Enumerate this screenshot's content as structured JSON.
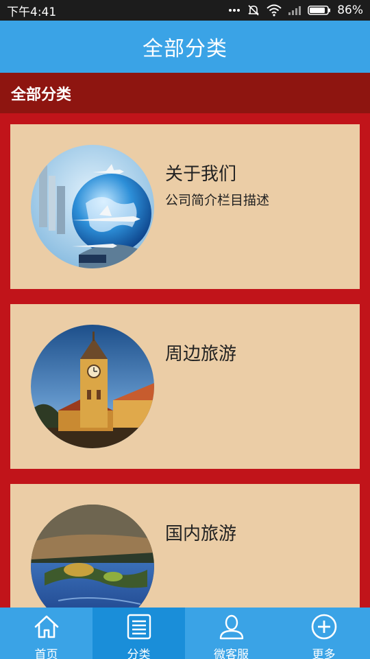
{
  "status_bar": {
    "time": "下午4:41",
    "battery": "86%",
    "icons": [
      "more-dots-icon",
      "no-alarm-icon",
      "wifi-icon",
      "signal-icon",
      "battery-icon"
    ]
  },
  "header": {
    "title": "全部分类"
  },
  "section": {
    "title": "全部分类"
  },
  "cards": [
    {
      "title": "关于我们",
      "desc": "公司简介栏目描述",
      "image": "globe-airplanes-image"
    },
    {
      "title": "周边旅游",
      "desc": "",
      "image": "clock-tower-image"
    },
    {
      "title": "国内旅游",
      "desc": "",
      "image": "lake-landscape-image"
    }
  ],
  "tabs": [
    {
      "label": "首页",
      "icon": "home-icon",
      "active": false
    },
    {
      "label": "分类",
      "icon": "list-icon",
      "active": true
    },
    {
      "label": "微客服",
      "icon": "user-icon",
      "active": false
    },
    {
      "label": "更多",
      "icon": "plus-circle-icon",
      "active": false
    }
  ],
  "colors": {
    "header_bg": "#3aa3e6",
    "section_bg": "#8e1510",
    "page_bg": "#c1141a",
    "card_bg": "#ebcda6",
    "tab_active_bg": "#1a8ed9"
  }
}
